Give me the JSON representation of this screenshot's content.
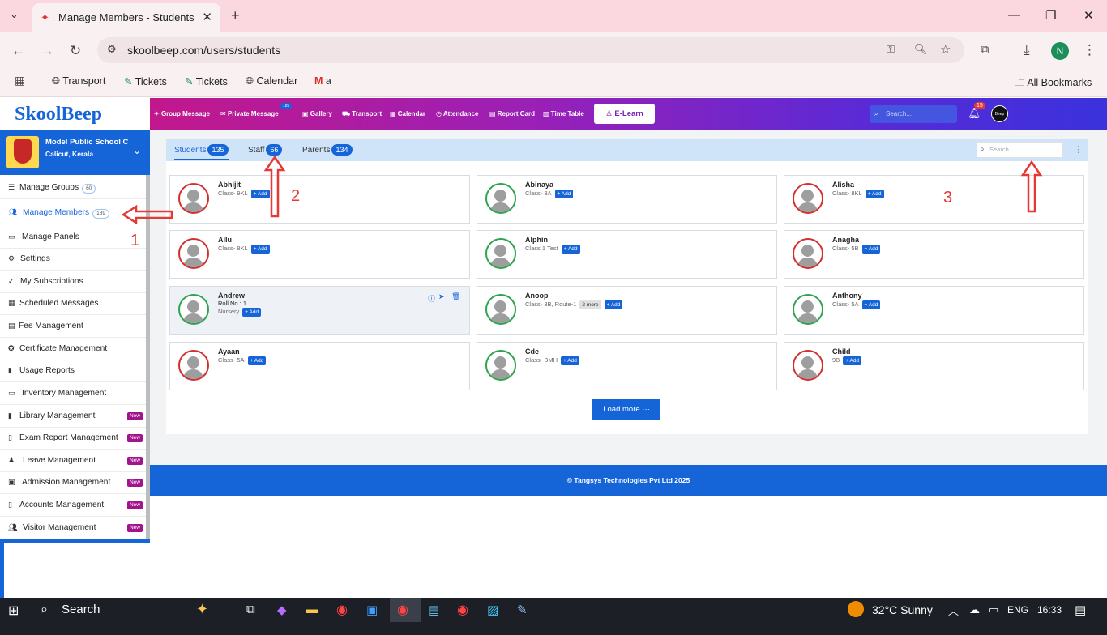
{
  "browser": {
    "tab_title": "Manage Members - Students",
    "url": "skoolbeep.com/users/students",
    "bookmarks": [
      "Transport",
      "Tickets",
      "Tickets",
      "Calendar",
      "a"
    ],
    "all_bookmarks": "All Bookmarks",
    "profile_initial": "N"
  },
  "app": {
    "logo": "SkoolBeep",
    "nav": [
      "Group Message",
      "Private Message",
      "Gallery",
      "Transport",
      "Calendar",
      "Attendance",
      "Report Card",
      "Time Table"
    ],
    "private_msg_badge": "189",
    "elearn": "E-Learn",
    "search_placeholder": "Search...",
    "notif_count": "15",
    "avatar_text": "Beep"
  },
  "school": {
    "name": "Model Public School C",
    "location": "Calicut, Kerala"
  },
  "sidebar": {
    "items": [
      {
        "label": "Manage Groups",
        "count": "60"
      },
      {
        "label": "Manage Members",
        "count": "189"
      },
      {
        "label": "Manage Panels"
      },
      {
        "label": "Settings"
      },
      {
        "label": "My Subscriptions"
      },
      {
        "label": "Scheduled Messages"
      },
      {
        "label": "Fee Management"
      },
      {
        "label": "Certificate Management"
      },
      {
        "label": "Usage Reports"
      },
      {
        "label": "Inventory Management"
      },
      {
        "label": "Library Management",
        "badge": "New"
      },
      {
        "label": "Exam Report Management",
        "badge": "New"
      },
      {
        "label": "Leave Management",
        "badge": "New"
      },
      {
        "label": "Admission Management",
        "badge": "New"
      },
      {
        "label": "Accounts Management",
        "badge": "New"
      },
      {
        "label": "Visitor Management",
        "badge": "New"
      }
    ]
  },
  "tabs": [
    {
      "label": "Students",
      "count": "135"
    },
    {
      "label": "Staff",
      "count": "66"
    },
    {
      "label": "Parents",
      "count": "134"
    }
  ],
  "content_search_placeholder": "Search...",
  "members": [
    {
      "name": "Abhijit",
      "sub": "Class- 9KL",
      "add": "+ Add"
    },
    {
      "name": "Abinaya",
      "sub": "Class- 3A",
      "add": "+ Add"
    },
    {
      "name": "Alisha",
      "sub": "Class- 8KL",
      "add": "+ Add"
    },
    {
      "name": "Allu",
      "sub": "Class- 8KL",
      "add": "+ Add"
    },
    {
      "name": "Alphin",
      "sub": "Class 1 Test",
      "add": "+ Add"
    },
    {
      "name": "Anagha",
      "sub": "Class- 5B",
      "add": "+ Add"
    },
    {
      "name": "Andrew",
      "roll": "Roll No : 1",
      "sub": "Nursery",
      "add": "+ Add"
    },
    {
      "name": "Anoop",
      "sub": "Class- 3B, Route-1",
      "more": "2 more",
      "add": "+ Add"
    },
    {
      "name": "Anthony",
      "sub": "Class- 5A",
      "add": "+ Add"
    },
    {
      "name": "Ayaan",
      "sub": "Class- 5A",
      "add": "+ Add"
    },
    {
      "name": "Cde",
      "sub": "Class- BMH",
      "add": "+ Add"
    },
    {
      "name": "Child",
      "sub": "9B",
      "add": "+ Add"
    }
  ],
  "load_more": "Load more ···",
  "footer": "© Tangsys Technologies Pvt Ltd 2025",
  "annotations": [
    "1",
    "2",
    "3"
  ],
  "taskbar": {
    "search": "Search",
    "weather": "32°C  Sunny",
    "lang": "ENG",
    "time": "16:33"
  }
}
